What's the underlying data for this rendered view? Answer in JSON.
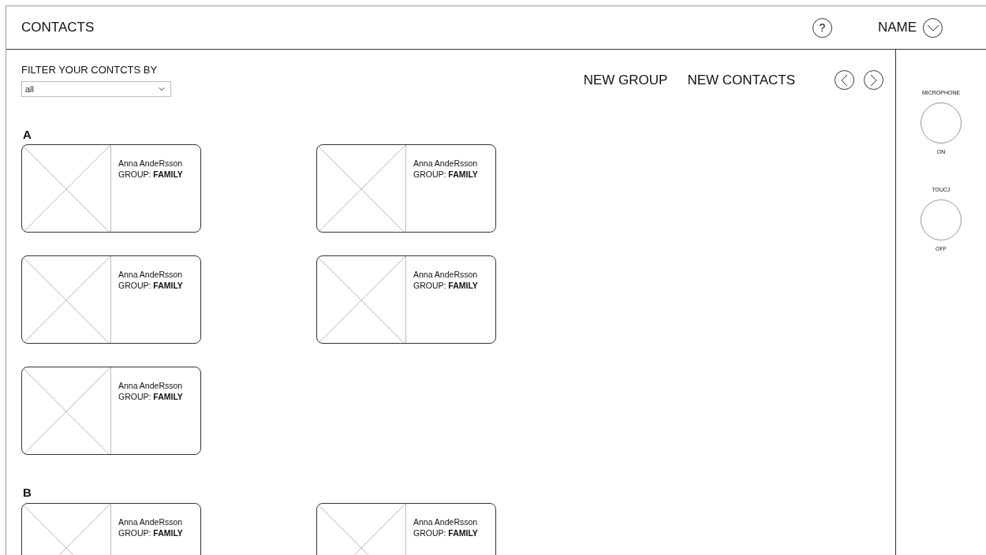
{
  "header": {
    "title": "CONTACTS",
    "help": "?",
    "user": "NAME"
  },
  "filter": {
    "label": "FILTER YOUR CONTCTS BY",
    "value": "all"
  },
  "actions": [
    "NEW GROUP",
    "NEW CONTACTS"
  ],
  "sections": [
    {
      "letter": "A",
      "contacts": [
        {
          "name": "Anna AndeRsson",
          "group": "GROUP: **FAMILY**"
        },
        {
          "name": "Anna AndeRsson",
          "group": "GROUP: **FAMILY**"
        },
        {
          "name": "Anna AndeRsson",
          "group": "GROUP: **FAMILY**"
        },
        {
          "name": "Anna AndeRsson",
          "group": "GROUP: **FAMILY**"
        },
        {
          "name": "Anna AndeRsson",
          "group": "GROUP: **FAMILY**"
        }
      ]
    },
    {
      "letter": "B",
      "contacts": [
        {
          "name": "Anna AndeRsson",
          "group": "GROUP: **FAMILY**"
        },
        {
          "name": "Anna AndeRsson",
          "group": "GROUP: **FAMILY**"
        }
      ]
    }
  ],
  "controls": [
    {
      "label": "MICROPHONE",
      "state": "ON"
    },
    {
      "label": "TOUCJ",
      "state": "OFF"
    }
  ]
}
